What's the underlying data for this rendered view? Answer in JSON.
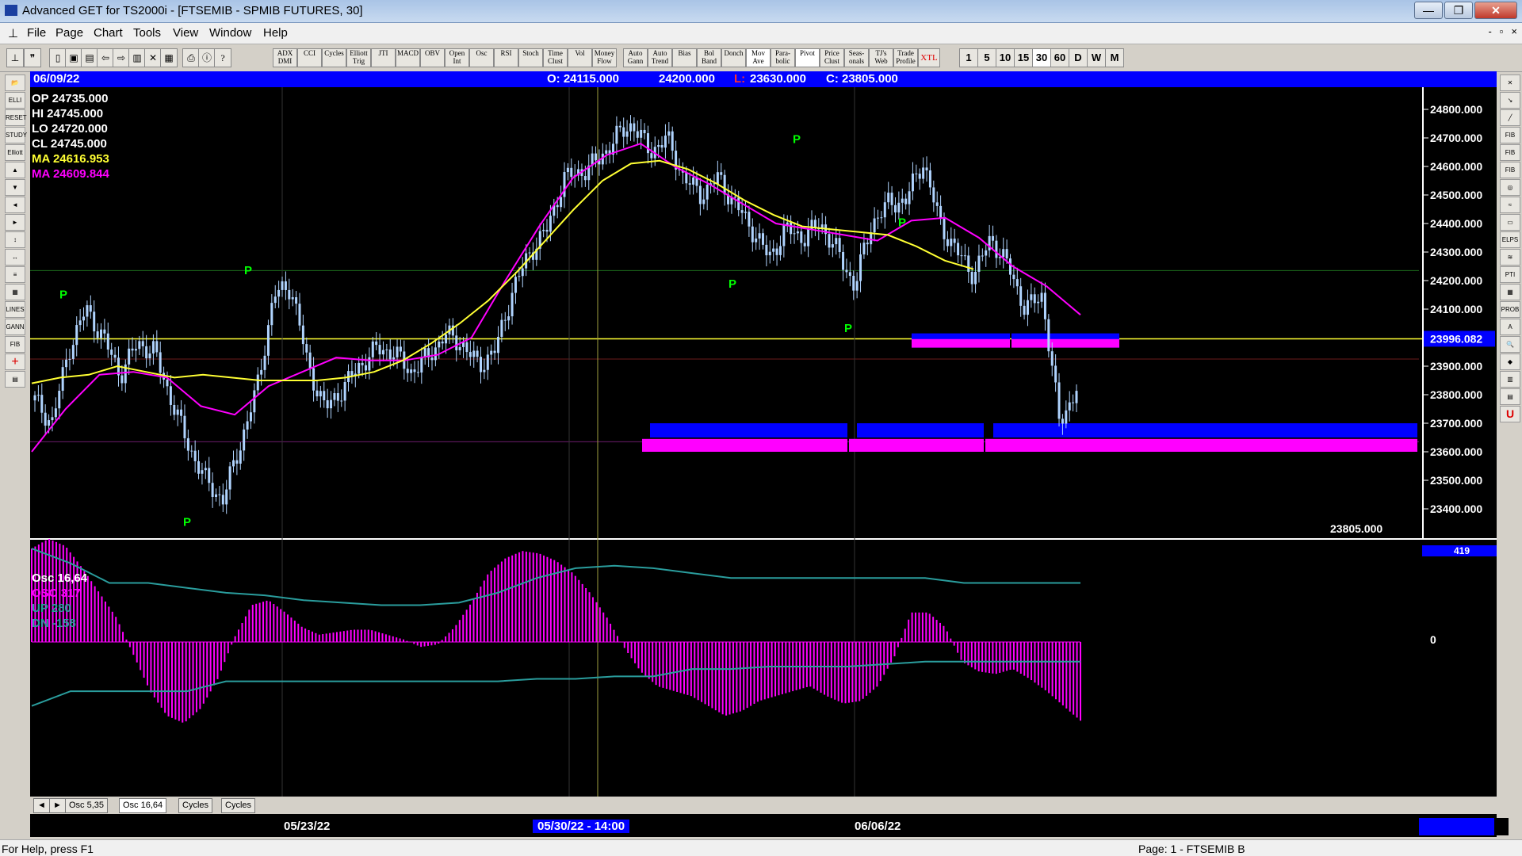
{
  "window": {
    "title": "Advanced GET for TS2000i - [FTSEMIB - SPMIB FUTURES, 30]",
    "buttons": [
      "—",
      "❐",
      "✕"
    ]
  },
  "menu": {
    "items": [
      "File",
      "Page",
      "Chart",
      "Tools",
      "View",
      "Window",
      "Help"
    ],
    "mdi_buttons": [
      "-",
      "▫",
      "×"
    ]
  },
  "toolbar": {
    "study_buttons": [
      "ADX DMI",
      "CCI",
      "Cycles",
      "Elliott Trig",
      "JTI",
      "MACD",
      "OBV",
      "Open Int",
      "Osc",
      "RSI",
      "Stoch",
      "Time Clust",
      "Vol",
      "Money Flow",
      "Auto Gann",
      "Auto Trend",
      "Bias",
      "Bol Band",
      "Donch",
      "Mov Ave",
      "Para- bolic",
      "Pivot",
      "Price Clust",
      "Seas- onals",
      "TJ's Web",
      "Trade Profile",
      "XTL"
    ],
    "interval_buttons": [
      "1",
      "5",
      "10",
      "15",
      "30",
      "60",
      "D",
      "W",
      "M"
    ],
    "active_interval": "30"
  },
  "left_tools": [
    "📂",
    "ELLI",
    "RESET",
    "STUDY",
    "Elliott",
    "▲",
    "▼",
    "◄",
    "►",
    "↕",
    "↔",
    "≡",
    "▦",
    "LINES",
    "GANN",
    "FIB",
    "+",
    "▤"
  ],
  "right_tools": [
    "✕",
    "↘",
    "╱",
    "FIB RET",
    "FIB EXT",
    "FIB TIME",
    "◎",
    "≈",
    "▭",
    "ELPS",
    "≋",
    "PTI",
    "▦",
    "PROB",
    "A",
    "🔍",
    "◆",
    "▥",
    "▤",
    "U"
  ],
  "infobar": {
    "date": "06/09/22",
    "open": "O: 24115.000",
    "high": "24200.000",
    "low_label": "L:",
    "low": "23630.000",
    "close": "C: 23805.000"
  },
  "price_legend": {
    "op": "OP  24735.000",
    "hi": "HI   24745.000",
    "lo": "LO  24720.000",
    "cl": "CL  24745.000",
    "ma1": "MA  24616.953",
    "ma2": "MA  24609.844"
  },
  "price_axis": {
    "labels": [
      "24800.000",
      "24700.000",
      "24600.000",
      "24500.000",
      "24400.000",
      "24300.000",
      "24200.000",
      "24100.000",
      "23996.082",
      "23900.000",
      "23800.000",
      "23700.000",
      "23600.000",
      "23500.000",
      "23400.000"
    ],
    "current_price": "23805.000",
    "highlight_price": "23996.082"
  },
  "osc_legend": {
    "title": "Osc 16,64",
    "osc": "OSC 317",
    "up": "UP   280",
    "dn": "DN   -158"
  },
  "osc_axis": {
    "top": "419",
    "zero": "0"
  },
  "tabs": [
    "◄",
    "►",
    "Osc 5,35",
    "Osc 16,64",
    "Cycles",
    "Cycles"
  ],
  "dates": {
    "d1": "05/23/22",
    "cursor": "05/30/22 - 14:00",
    "d2": "06/06/22"
  },
  "pivots": [
    "P",
    "P",
    "P",
    "P",
    "P",
    "P",
    "P"
  ],
  "colors": {
    "candle": "#b0d4ff",
    "ma_fast": "#ffff33",
    "ma_slow": "#ff00ff",
    "zone_blue": "#0000ff",
    "zone_magenta": "#ff00ff",
    "osc_hist": "#ff00ff",
    "osc_band": "#2a9d9d",
    "pivot": "#00ff00"
  },
  "chart_data": {
    "type": "candlestick",
    "instrument": "FTSEMIB - SPMIB FUTURES",
    "interval": "30",
    "ylim": [
      23350,
      24850
    ],
    "close_series": [
      23780,
      23700,
      23960,
      24100,
      24000,
      23870,
      23980,
      23950,
      23780,
      23620,
      23500,
      23430,
      23620,
      23820,
      24150,
      24180,
      23900,
      23750,
      23820,
      23900,
      23960,
      23950,
      23880,
      23930,
      24010,
      23980,
      23900,
      23960,
      24170,
      24300,
      24380,
      24560,
      24580,
      24620,
      24700,
      24750,
      24650,
      24700,
      24560,
      24500,
      24560,
      24470,
      24380,
      24280,
      24380,
      24350,
      24400,
      24300,
      24180,
      24400,
      24470,
      24480,
      24620,
      24400,
      24300,
      24220,
      24350,
      24250,
      24100,
      24150,
      23700,
      23820
    ],
    "ma_fast": [
      23840,
      23860,
      23870,
      23900,
      23880,
      23860,
      23870,
      23860,
      23850,
      23850,
      23850,
      23860,
      23880,
      23920,
      23980,
      24050,
      24130,
      24230,
      24340,
      24450,
      24550,
      24610,
      24620,
      24590,
      24540,
      24480,
      24430,
      24390,
      24380,
      24370,
      24360,
      24320,
      24270,
      24240
    ],
    "ma_slow": [
      23600,
      23750,
      23870,
      23880,
      23860,
      23760,
      23730,
      23830,
      23880,
      23930,
      23920,
      23920,
      23940,
      24000,
      24200,
      24390,
      24560,
      24640,
      24680,
      24600,
      24540,
      24470,
      24400,
      24380,
      24360,
      24340,
      24410,
      24420,
      24350,
      24250,
      24180,
      24080
    ],
    "zones": [
      {
        "blue": [
          23965,
          24015
        ],
        "magenta": [
          23965,
          23995
        ]
      },
      {
        "blue": [
          23650,
          23700
        ],
        "magenta": [
          23600,
          23645
        ]
      }
    ],
    "oscillator": {
      "name": "Osc 16,64",
      "osc": 317,
      "up": 280,
      "dn": -158,
      "scale_top": 419
    }
  }
}
